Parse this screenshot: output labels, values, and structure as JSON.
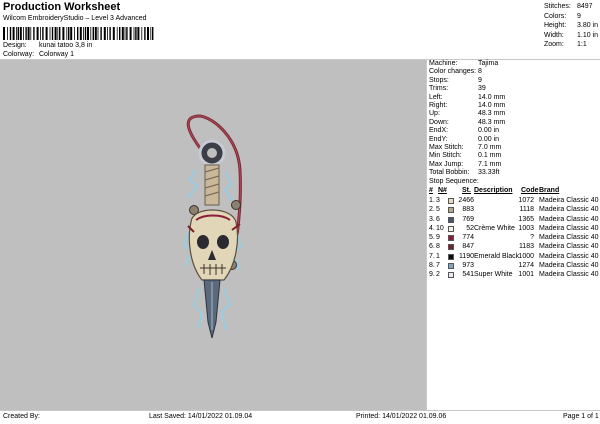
{
  "header": {
    "title": "Production Worksheet",
    "subtitle": "Wilcom EmbroideryStudio – Level 3 Advanced",
    "design_label": "Design:",
    "design_value": "kunai tatoo 3,8 in",
    "colorway_label": "Colorway:",
    "colorway_value": "Colorway 1"
  },
  "stats": [
    {
      "label": "Stitches:",
      "value": "8497"
    },
    {
      "label": "Colors:",
      "value": "9"
    },
    {
      "label": "Height:",
      "value": "3.80 in"
    },
    {
      "label": "Width:",
      "value": "1.10 in"
    },
    {
      "label": "Zoom:",
      "value": "1:1"
    }
  ],
  "machine_info": [
    {
      "label": "Machine:",
      "value": "Tajima"
    },
    {
      "label": "Color changes:",
      "value": "8"
    },
    {
      "label": "Stops:",
      "value": "9"
    },
    {
      "label": "Trims:",
      "value": "39"
    },
    {
      "label": "Left:",
      "value": "14.0 mm"
    },
    {
      "label": "Right:",
      "value": "14.0 mm"
    },
    {
      "label": "Up:",
      "value": "48.3 mm"
    },
    {
      "label": "Down:",
      "value": "48.3 mm"
    },
    {
      "label": "EndX:",
      "value": "0.00 in"
    },
    {
      "label": "EndY:",
      "value": "0.00 in"
    },
    {
      "label": "Max Stitch:",
      "value": "7.0 mm"
    },
    {
      "label": "Min Stitch:",
      "value": "0.1 mm"
    },
    {
      "label": "Max Jump:",
      "value": "7.1 mm"
    },
    {
      "label": "Total Bobbin:",
      "value": "33.33ft"
    }
  ],
  "stop_sequence": {
    "title": "Stop Sequence:",
    "headers": {
      "num": "#",
      "n": "N#",
      "st": "St.",
      "desc": "Description",
      "code": "Code",
      "brand": "Brand"
    },
    "rows": [
      {
        "num": "1.",
        "n": "3",
        "color": "#e9dcc2",
        "st": "2466",
        "desc": "",
        "code": "1072",
        "brand": "Madeira Classic 40"
      },
      {
        "num": "2.",
        "n": "5",
        "color": "#b8a58e",
        "st": "883",
        "desc": "",
        "code": "1118",
        "brand": "Madeira Classic 40"
      },
      {
        "num": "3.",
        "n": "6",
        "color": "#47586a",
        "st": "769",
        "desc": "",
        "code": "1365",
        "brand": "Madeira Classic 40"
      },
      {
        "num": "4.",
        "n": "10",
        "color": "#f5f1e2",
        "st": "52",
        "desc": "Crème White",
        "code": "1003",
        "brand": "Madeira Classic 40"
      },
      {
        "num": "5.",
        "n": "9",
        "color": "#8a1e3a",
        "st": "774",
        "desc": "",
        "code": "?",
        "brand": "Madeira Classic 40"
      },
      {
        "num": "6.",
        "n": "8",
        "color": "#7a1f27",
        "st": "847",
        "desc": "",
        "code": "1183",
        "brand": "Madeira Classic 40"
      },
      {
        "num": "7.",
        "n": "1",
        "color": "#0d0d10",
        "st": "1190",
        "desc": "Emerald Black",
        "code": "1000",
        "brand": "Madeira Classic 40"
      },
      {
        "num": "8.",
        "n": "7",
        "color": "#7fa6c4",
        "st": "973",
        "desc": "",
        "code": "1274",
        "brand": "Madeira Classic 40"
      },
      {
        "num": "9.",
        "n": "2",
        "color": "#e8eaf2",
        "st": "541",
        "desc": "Super White",
        "code": "1001",
        "brand": "Madeira Classic 40"
      }
    ]
  },
  "footer": {
    "created_by": "Created By:",
    "last_saved": "Last Saved: 14/01/2022 01.09.04",
    "printed": "Printed: 14/01/2022 01.09.06",
    "page": "Page 1 of 1"
  },
  "design_preview": {
    "description_icon": "kunai-skull-embroidery-icon"
  }
}
